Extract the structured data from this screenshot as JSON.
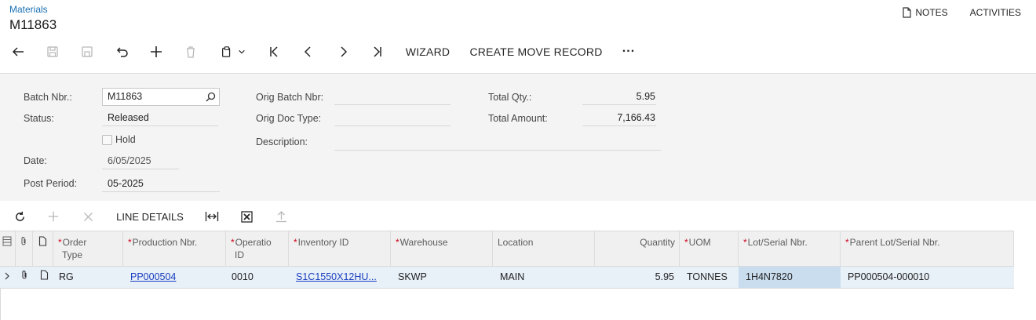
{
  "breadcrumb": "Materials",
  "title": "M11863",
  "top_links": {
    "notes": "NOTES",
    "activities": "ACTIVITIES"
  },
  "toolbar": {
    "wizard": "WIZARD",
    "create_move": "CREATE MOVE RECORD",
    "more": "···"
  },
  "form": {
    "batch_nbr_label": "Batch Nbr.:",
    "batch_nbr": "M11863",
    "status_label": "Status:",
    "status": "Released",
    "hold_label": "Hold",
    "date_label": "Date:",
    "date": "6/05/2025",
    "post_period_label": "Post Period:",
    "post_period": "05-2025",
    "orig_batch_label": "Orig Batch Nbr:",
    "orig_doc_label": "Orig Doc Type:",
    "description_label": "Description:",
    "total_qty_label": "Total Qty.:",
    "total_qty": "5.95",
    "total_amount_label": "Total Amount:",
    "total_amount": "7,166.43"
  },
  "grid_toolbar": {
    "line_details": "LINE DETAILS"
  },
  "grid": {
    "headers": {
      "order_type_1": "Order",
      "order_type_2": "Type",
      "production_nbr": "Production Nbr.",
      "operation_1": "Operatio",
      "operation_2": "ID",
      "inventory_id": "Inventory ID",
      "warehouse": "Warehouse",
      "location": "Location",
      "quantity": "Quantity",
      "uom": "UOM",
      "lot_serial": "Lot/Serial Nbr.",
      "parent_lot": "Parent Lot/Serial Nbr."
    },
    "row": {
      "order_type": "RG",
      "production_nbr": "PP000504",
      "operation": "0010",
      "inventory_id": "S1C1550X12HU...",
      "warehouse": "SKWP",
      "location": "MAIN",
      "quantity": "5.95",
      "uom": "TONNES",
      "lot_serial": "1H4N7820",
      "parent_lot": "PP000504-000010"
    }
  }
}
